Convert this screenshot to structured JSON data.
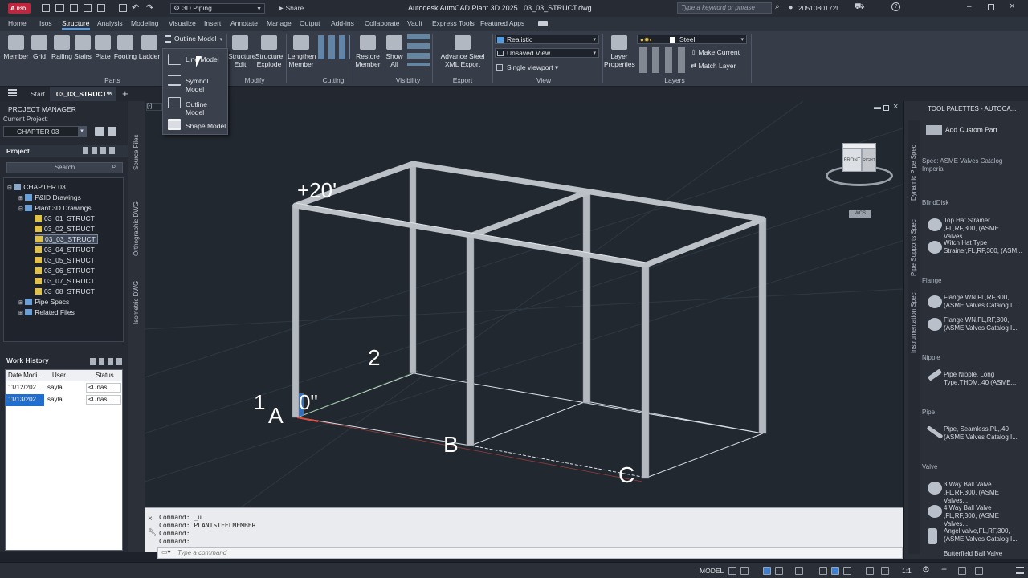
{
  "app": {
    "badge": "A",
    "badge_sub": "P3D",
    "workspace": "3D Piping",
    "share": "Share",
    "title": "Autodesk AutoCAD Plant 3D 2025   03_03_STRUCT.dwg",
    "search_placeholder": "Type a keyword or phrase",
    "user": "2051080172l"
  },
  "ribbon_tabs": [
    "Home",
    "Isos",
    "Structure",
    "Analysis",
    "Modeling",
    "Visualize",
    "Insert",
    "Annotate",
    "Manage",
    "Output",
    "Add-ins",
    "Collaborate",
    "Vault",
    "Express Tools",
    "Featured Apps"
  ],
  "ribbon_active_tab": "Structure",
  "ribbon": {
    "parts_buttons": [
      "Member",
      "Grid",
      "Railing",
      "Stairs",
      "Plate",
      "Footing",
      "Ladder"
    ],
    "parts_label": "Parts",
    "outline_model": "Outline Model",
    "modify_buttons": [
      "Structure Edit",
      "Structure Explode"
    ],
    "modify_label": "Modify",
    "cutting_buttons": [
      "Lengthen Member"
    ],
    "cutting_label": "Cutting",
    "restore_member": "Restore Member",
    "show_all": "Show All",
    "visibility_label": "Visibility",
    "export_button": "Advance Steel XML Export",
    "export_label": "Export",
    "visual_style": "Realistic",
    "view_name": "Unsaved View",
    "viewport_config": "Single viewport",
    "view_label": "View",
    "layer_properties": "Layer Properties",
    "layer_current": "Steel",
    "make_current": "Make Current",
    "match_layer": "Match Layer",
    "layers_label": "Layers"
  },
  "dropdown": {
    "items": [
      "Line Model",
      "Symbol Model",
      "Outline Model",
      "Shape Model"
    ]
  },
  "doc_tabs": [
    "Start",
    "03_03_STRUCT*"
  ],
  "project_manager": {
    "title": "PROJECT MANAGER",
    "current_project_label": "Current Project:",
    "current_project": "CHAPTER 03",
    "project_label": "Project",
    "search_placeholder": "Search",
    "tree": [
      {
        "label": "CHAPTER 03",
        "level": 0
      },
      {
        "label": "P&ID Drawings",
        "level": 1
      },
      {
        "label": "Plant 3D Drawings",
        "level": 1
      },
      {
        "label": "03_01_STRUCT",
        "level": 2
      },
      {
        "label": "03_02_STRUCT",
        "level": 2
      },
      {
        "label": "03_03_STRUCT",
        "level": 2
      },
      {
        "label": "03_04_STRUCT",
        "level": 2
      },
      {
        "label": "03_05_STRUCT",
        "level": 2
      },
      {
        "label": "03_06_STRUCT",
        "level": 2
      },
      {
        "label": "03_07_STRUCT",
        "level": 2
      },
      {
        "label": "03_08_STRUCT",
        "level": 2
      },
      {
        "label": "Pipe Specs",
        "level": 1
      },
      {
        "label": "Related Files",
        "level": 1
      }
    ],
    "selected_index": 5
  },
  "work_history": {
    "title": "Work History",
    "columns": [
      "Date Modi...",
      "User",
      "Status"
    ],
    "rows": [
      [
        "11/12/202...",
        "sayla",
        "<Unas..."
      ],
      [
        "11/13/202...",
        "sayla",
        "<Unas..."
      ]
    ]
  },
  "side_tabs": [
    "Source Files",
    "Orthographic DWG",
    "Isometric DWG"
  ],
  "viewport": {
    "labels": [
      "+20'",
      "2",
      "1",
      "A",
      "0\"",
      "B",
      "C"
    ],
    "viewcube_front": "FRONT",
    "viewcube_right": "RIGHT",
    "wcs": "WCS"
  },
  "command": {
    "history": [
      "Command: PLANTSTEELMEMBER",
      "Command: _u",
      "Command: PLANTSTEELMEMBER",
      "Command:",
      "Command:"
    ],
    "prompt_placeholder": "Type a command"
  },
  "tool_palettes": {
    "title": "TOOL PALETTES - AUTOCA...",
    "tabs": [
      "Dynamic Pipe Spec",
      "Pipe Supports Spec",
      "Instrumentation Spec"
    ],
    "add_custom_part": "Add Custom Part",
    "spec": "Spec: ASME Valves Catalog Imperial",
    "sections": [
      {
        "heading": "BlindDisk",
        "items": [
          "Top Hat Strainer ,FL,RF,300, (ASME Valves...",
          "Witch Hat Type Strainer,FL,RF,300, (ASM..."
        ]
      },
      {
        "heading": "Flange",
        "items": [
          "Flange WN,FL,RF,300, (ASME Valves Catalog I...",
          "Flange WN,FL,RF,300, (ASME Valves Catalog I..."
        ]
      },
      {
        "heading": "Nipple",
        "items": [
          "Pipe Nipple, Long Type,THDM,,40 (ASME..."
        ]
      },
      {
        "heading": "Pipe",
        "items": [
          "Pipe, Seamless,PL,,40 (ASME Valves Catalog I..."
        ]
      },
      {
        "heading": "Valve",
        "items": [
          "3 Way Ball Valve ,FL,RF,300, (ASME Valves...",
          "4 Way Ball Valve ,FL,RF,300, (ASME Valves...",
          "Angel valve,FL,RF,300, (ASME Valves Catalog I...",
          "Butterfield Ball Valve"
        ]
      }
    ]
  },
  "status": {
    "model": "MODEL",
    "scale": "1:1"
  }
}
